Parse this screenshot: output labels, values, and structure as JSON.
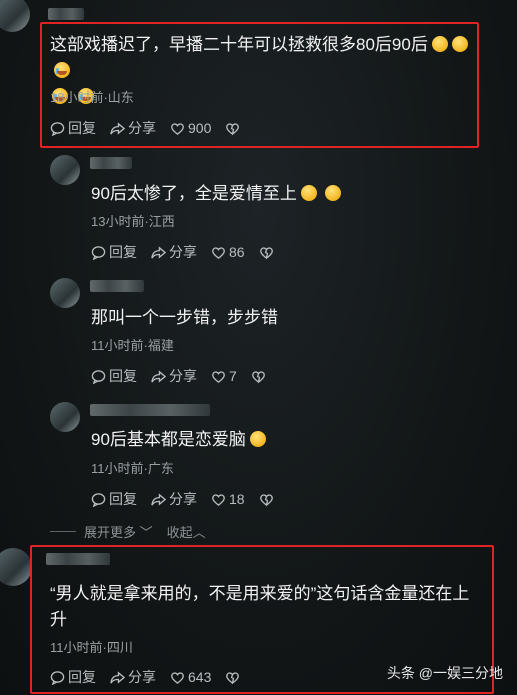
{
  "comments": [
    {
      "text": "这部戏播迟了，早播二十年可以拯救很多80后90后",
      "meta": "18小时前·山东",
      "reply": "回复",
      "share": "分享",
      "likes": "900"
    },
    {
      "text": "90后太惨了，全是爱情至上",
      "meta": "13小时前·江西",
      "reply": "回复",
      "share": "分享",
      "likes": "86"
    },
    {
      "text": "那叫一个一步错，步步错",
      "meta": "11小时前·福建",
      "reply": "回复",
      "share": "分享",
      "likes": "7"
    },
    {
      "text": "90后基本都是恋爱脑",
      "meta": "11小时前·广东",
      "reply": "回复",
      "share": "分享",
      "likes": "18"
    },
    {
      "text_line1": "“男人就是拿来用的，不是用来爱的”这句话含金量还在上",
      "text_line2": "升",
      "meta": "11小时前·四川",
      "reply": "回复",
      "share": "分享",
      "likes": "643"
    }
  ],
  "expand": {
    "more": "展开更多",
    "collapse": "收起"
  },
  "watermark": "头条 @一娱三分地",
  "colors": {
    "highlight": "#e02424",
    "background": "#121617"
  }
}
